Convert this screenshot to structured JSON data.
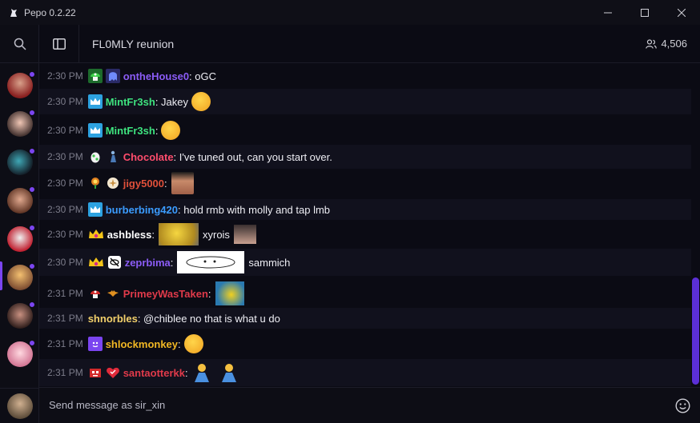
{
  "window": {
    "title": "Pepo 0.2.22"
  },
  "header": {
    "channel_title": "FL0MLY reunion",
    "viewer_count": "4,506"
  },
  "input": {
    "placeholder": "Send message as sir_xin"
  },
  "colors": {
    "accent": "#7b45f0",
    "scroll_thumb": "#5b2fd6"
  },
  "messages": [
    {
      "time": "2:30 PM",
      "user": "ontheHouse0",
      "user_color": "#8b5cf6",
      "text": ": oGC",
      "badges": [
        "mushroom-badge-icon",
        "ghost-badge-icon"
      ]
    },
    {
      "time": "2:30 PM",
      "user": "MintFr3sh",
      "user_color": "#3ee37f",
      "text": ": Jakey",
      "badges": [
        "crown-badge-icon"
      ],
      "after": "laughing-emoji"
    },
    {
      "time": "2:30 PM",
      "user": "MintFr3sh",
      "user_color": "#3ee37f",
      "text": ":",
      "badges": [
        "crown-badge-icon"
      ],
      "after": "smirk-emoji"
    },
    {
      "time": "2:30 PM",
      "user": "Chocolate",
      "user_color": "#ff4d6d",
      "text": ": I've tuned out, can you start over.",
      "badges": [
        "egg-badge-icon",
        "figure-badge-icon"
      ]
    },
    {
      "time": "2:30 PM",
      "user": "jigy5000",
      "user_color": "#e0503a",
      "text": ":",
      "badges": [
        "flower-badge-icon",
        "star-badge-icon"
      ],
      "after": "flex-emote"
    },
    {
      "time": "2:30 PM",
      "user": "burberbing420",
      "user_color": "#3b9cff",
      "text": ": hold rmb with molly and tap lmb",
      "badges": [
        "crown-badge-icon"
      ]
    },
    {
      "time": "2:30 PM",
      "user": "ashbless",
      "user_color": "#ffffff",
      "text": ":",
      "badges": [
        "king-badge-icon"
      ],
      "after": "minion-emote",
      "text2": "xyrois"
    },
    {
      "time": "2:30 PM",
      "user": "zeprbima",
      "user_color": "#8b5cf6",
      "text": ":",
      "badges": [
        "king-badge-icon",
        "no-eye-badge-icon"
      ],
      "after": "doodle-emote",
      "text2": "sammich"
    },
    {
      "time": "2:31 PM",
      "user": "PrimeyWasTaken",
      "user_color": "#e03a4a",
      "text": ":",
      "badges": [
        "mushroom-red-badge-icon",
        "bat-badge-icon"
      ],
      "after": "fish-emote"
    },
    {
      "time": "2:31 PM",
      "user": "shnorbles",
      "user_color": "#f2d06b",
      "text": ": @chiblee no that is what u do",
      "badges": []
    },
    {
      "time": "2:31 PM",
      "user": "shlockmonkey",
      "user_color": "#f2b824",
      "text": ":",
      "badges": [
        "purple-face-badge-icon"
      ],
      "after": "smirk-emoji"
    },
    {
      "time": "2:31 PM",
      "user": "santaotterkk",
      "user_color": "#e03a4a",
      "text": ":",
      "badges": [
        "robot-badge-icon",
        "heart-badge-icon"
      ],
      "after": "pray-emoji"
    }
  ]
}
